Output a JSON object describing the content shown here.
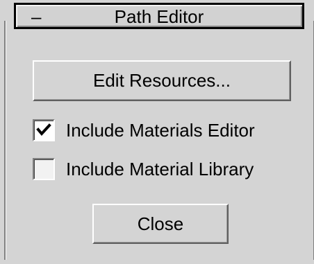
{
  "rollout": {
    "collapse_symbol": "–",
    "title": "Path Editor"
  },
  "buttons": {
    "edit_resources": "Edit Resources...",
    "close": "Close"
  },
  "options": [
    {
      "label": "Include Materials Editor",
      "checked": true
    },
    {
      "label": "Include Material Library",
      "checked": false
    }
  ],
  "icons": {
    "collapse": "minus-icon",
    "check": "checkmark-icon"
  }
}
